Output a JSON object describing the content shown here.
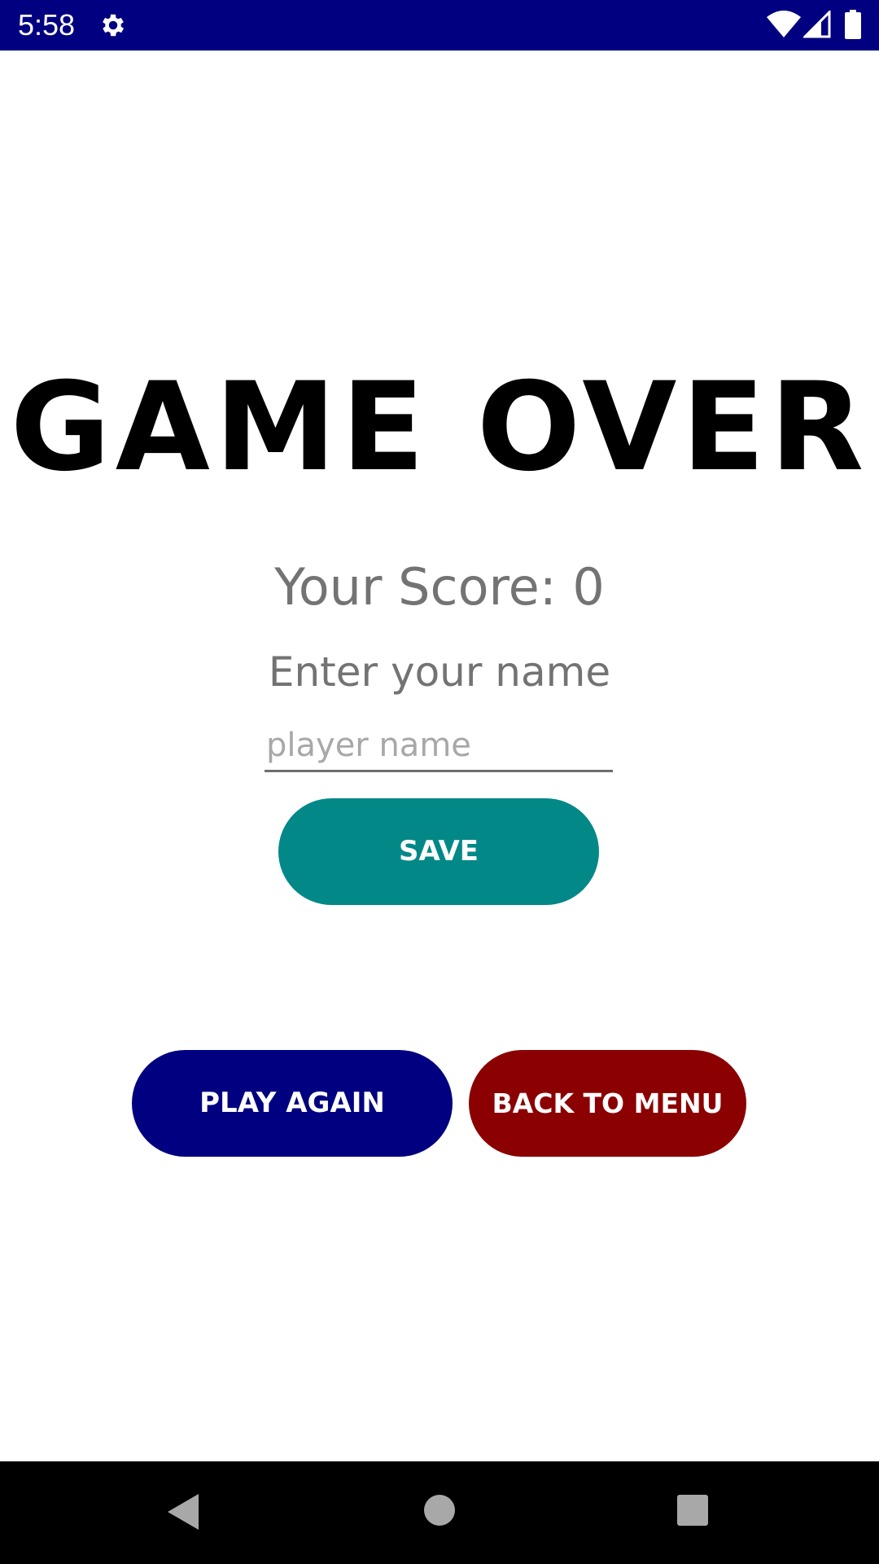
{
  "status_bar": {
    "time": "5:58",
    "background_color": "#010080",
    "icons": [
      "gear-icon",
      "wifi-icon",
      "cell-signal-icon",
      "battery-icon"
    ]
  },
  "game_over": {
    "title": "GAME OVER",
    "score_text": "Your Score: 0",
    "enter_name_label": "Enter your name",
    "name_input": {
      "value": "",
      "placeholder": "player name"
    },
    "save_label": "SAVE",
    "play_again_label": "PLAY AGAIN",
    "back_to_menu_label": "BACK TO MENU"
  },
  "colors": {
    "save_button": "#028887",
    "play_again_button": "#010080",
    "back_to_menu_button": "#8b0000",
    "secondary_text": "#737373"
  },
  "nav_bar": {
    "icons": [
      "back-icon",
      "home-icon",
      "recents-icon"
    ]
  }
}
